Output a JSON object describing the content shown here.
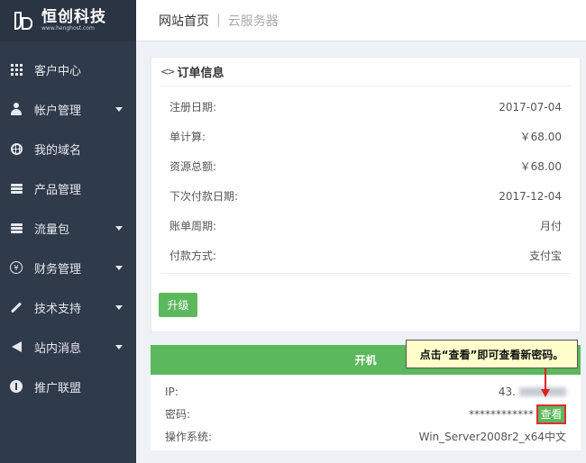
{
  "brand": {
    "name": "恒创科技",
    "sub": "www.henghost.com"
  },
  "sidebar": {
    "items": [
      {
        "label": "客户中心",
        "icon": "grid-icon",
        "has_submenu": false
      },
      {
        "label": "帐户管理",
        "icon": "user-icon",
        "has_submenu": true
      },
      {
        "label": "我的域名",
        "icon": "globe-icon",
        "has_submenu": false
      },
      {
        "label": "产品管理",
        "icon": "server-icon",
        "has_submenu": false
      },
      {
        "label": "流量包",
        "icon": "server-icon",
        "has_submenu": true
      },
      {
        "label": "财务管理",
        "icon": "yen-icon",
        "has_submenu": true
      },
      {
        "label": "技术支持",
        "icon": "pencil-icon",
        "has_submenu": true
      },
      {
        "label": "站内消息",
        "icon": "bullhorn-icon",
        "has_submenu": true
      },
      {
        "label": "推广联盟",
        "icon": "share-icon",
        "has_submenu": false
      }
    ]
  },
  "breadcrumb": {
    "home": "网站首页",
    "separator": "|",
    "current": "云服务器"
  },
  "order": {
    "title": "订单信息",
    "rows": [
      {
        "label": "注册日期:",
        "value": "2017-07-04"
      },
      {
        "label": "单计算:",
        "value": "￥68.00"
      },
      {
        "label": "资源总额:",
        "value": "￥68.00"
      },
      {
        "label": "下次付款日期:",
        "value": "2017-12-04"
      },
      {
        "label": "账单周期:",
        "value": "月付"
      },
      {
        "label": "付款方式:",
        "value": "支付宝"
      }
    ],
    "upgrade_label": "升级"
  },
  "power": {
    "title": "开机",
    "ip_label": "IP:",
    "ip_value": "43.",
    "password_label": "密码:",
    "password_value": "************",
    "view_label": "查看",
    "os_label": "操作系统:",
    "os_value": "Win_Server2008r2_x64中文"
  },
  "callout": {
    "text": "点击“查看”即可查看新密码。"
  },
  "colors": {
    "sidebar_bg": "#2f3a4a",
    "accent_green": "#5cb85c",
    "highlight_red": "#d9312c",
    "callout_bg": "#ffffcc"
  }
}
